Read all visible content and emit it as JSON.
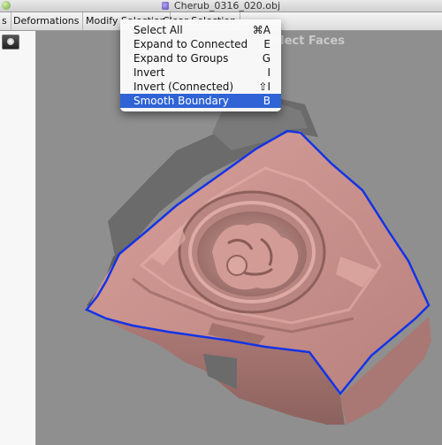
{
  "window": {
    "title": "Cherub_0316_020.obj"
  },
  "menubar": {
    "items": [
      {
        "label": "s"
      },
      {
        "label": "Deformations"
      },
      {
        "label": "Modify Selection"
      },
      {
        "label": "Clear Selection"
      }
    ]
  },
  "viewport": {
    "mode_label": "Select Faces"
  },
  "dropdown": {
    "items": [
      {
        "label": "Select All",
        "shortcut": "⌘A"
      },
      {
        "label": "Expand to Connected",
        "shortcut": "E"
      },
      {
        "label": "Expand to Groups",
        "shortcut": "G"
      },
      {
        "label": "Invert",
        "shortcut": "I"
      },
      {
        "label": "Invert (Connected)",
        "shortcut": "⇧I"
      },
      {
        "label": "Smooth Boundary",
        "shortcut": "B",
        "selected": true
      }
    ]
  },
  "colors": {
    "selection_boundary": "#1533e6",
    "mesh_selected": "#c98a86",
    "mesh_unselected": "#6f6f6f",
    "menu_highlight": "#2f63d6"
  }
}
